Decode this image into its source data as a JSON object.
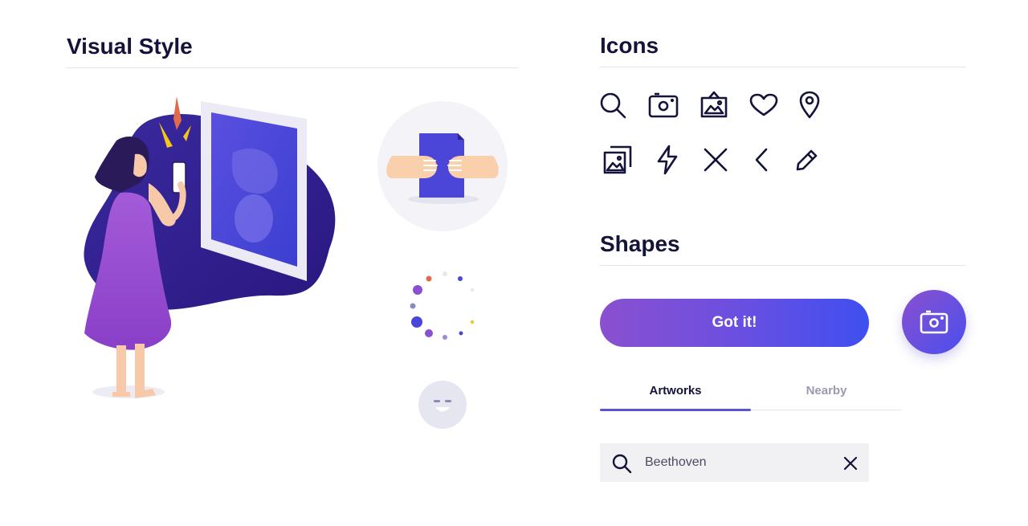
{
  "sections": {
    "visual_style": "Visual Style",
    "icons": "Icons",
    "shapes": "Shapes"
  },
  "icons": [
    "search-icon",
    "camera-icon",
    "image-frame-icon",
    "heart-icon",
    "location-pin-icon",
    "gallery-icon",
    "lightning-icon",
    "close-icon",
    "chevron-left-icon",
    "pencil-icon"
  ],
  "shapes": {
    "primary_button_label": "Got it!",
    "fab_icon": "camera-icon"
  },
  "tabs": [
    {
      "label": "Artworks",
      "active": true
    },
    {
      "label": "Nearby",
      "active": false
    }
  ],
  "search": {
    "value": "Beethoven",
    "placeholder": ""
  },
  "colors": {
    "title": "#14133a",
    "accent_start": "#8a50cf",
    "accent_end": "#3f4ff0",
    "tab_active": "#5b55d6",
    "tab_inactive": "#9a9ab0",
    "search_bg": "#f1f1f4"
  }
}
